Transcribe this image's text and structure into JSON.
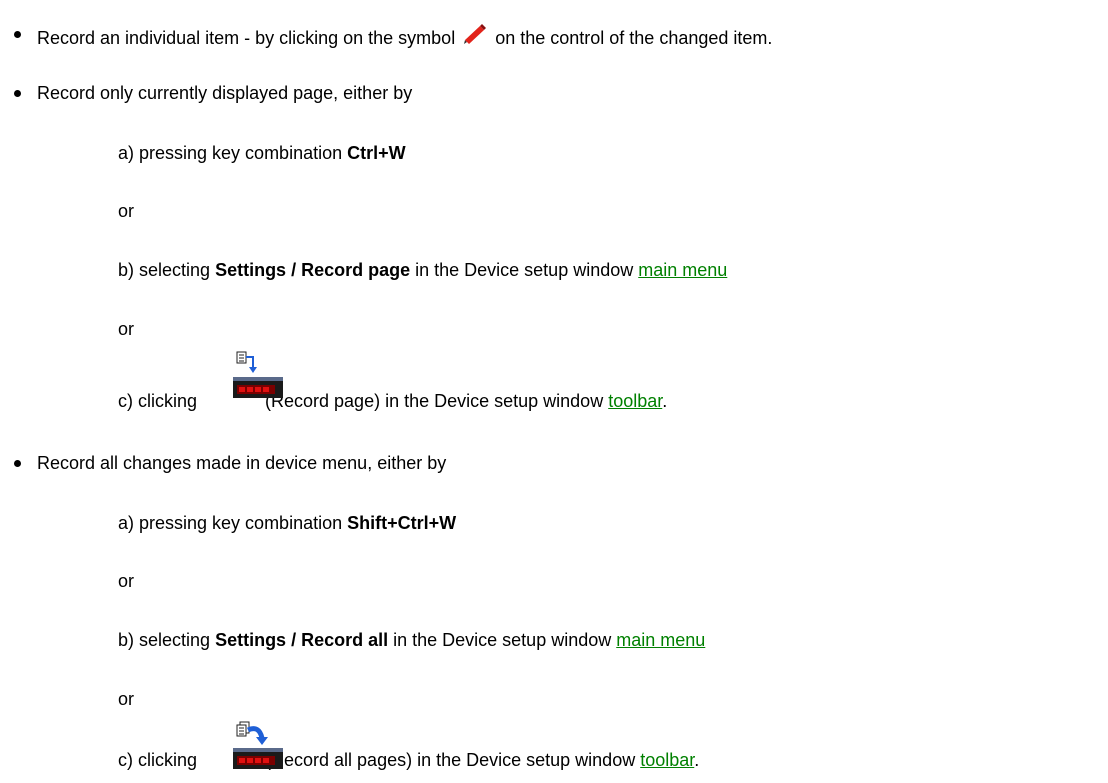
{
  "items": [
    {
      "text_before": "Record an individual item - by clicking on the symbol ",
      "icon": "pencil-icon",
      "text_after": " on the control of the changed item."
    },
    {
      "intro": "Record only currently displayed page, either by",
      "step_a": {
        "prefix": "a) pressing key combination ",
        "keys": "Ctrl+W"
      },
      "or1": "or",
      "step_b": {
        "prefix": "b) selecting ",
        "command": "Settings / Record page",
        "middle": " in the Device setup window ",
        "link": "main menu"
      },
      "or2": "or",
      "step_c": {
        "prefix": "c) clicking ",
        "icon": "record-page-icon",
        "label": " (Record page) in the Device setup window ",
        "link": "toolbar",
        "end": "."
      }
    },
    {
      "intro": "Record all changes made in device menu, either by",
      "step_a": {
        "prefix": "a) pressing key combination ",
        "keys": "Shift+Ctrl+W"
      },
      "or1": "or",
      "step_b": {
        "prefix": "b) selecting ",
        "command": "Settings / Record all",
        "middle": " in the Device setup window ",
        "link": "main menu"
      },
      "or2": "or",
      "step_c": {
        "prefix": "c) clicking ",
        "icon": "record-all-pages-icon",
        "label": " (Record all pages) in the Device setup window ",
        "link": "toolbar",
        "end": "."
      }
    }
  ],
  "colors": {
    "link": "#008000",
    "text": "#000000",
    "device_body": "#1a1a1a",
    "device_digits": "#e01010",
    "arrow": "#1f5fd6"
  }
}
